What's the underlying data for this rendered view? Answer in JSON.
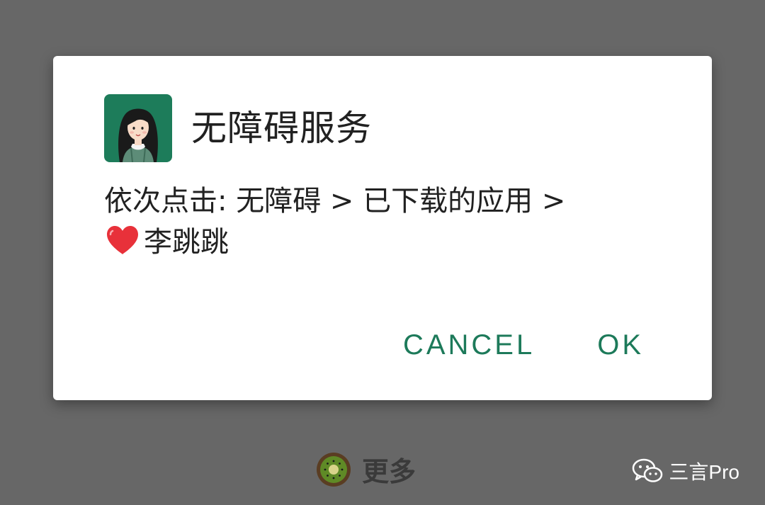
{
  "dialog": {
    "title": "无障碍服务",
    "icon": "girl-avatar-icon",
    "message_line1": "依次点击: 无障碍 > 已下载的应用 >",
    "message_line2": "李跳跳",
    "message_icon": "red-heart-icon",
    "cancel_label": "CANCEL",
    "ok_label": "OK"
  },
  "background": {
    "more_label": "更多",
    "more_icon": "kiwi-icon",
    "watermark_label": "三言Pro",
    "watermark_icon": "wechat-icon"
  },
  "colors": {
    "accent": "#1d7a5a",
    "scrim": "#676767",
    "dialog_bg": "#ffffff",
    "heart": "#e8313a"
  }
}
